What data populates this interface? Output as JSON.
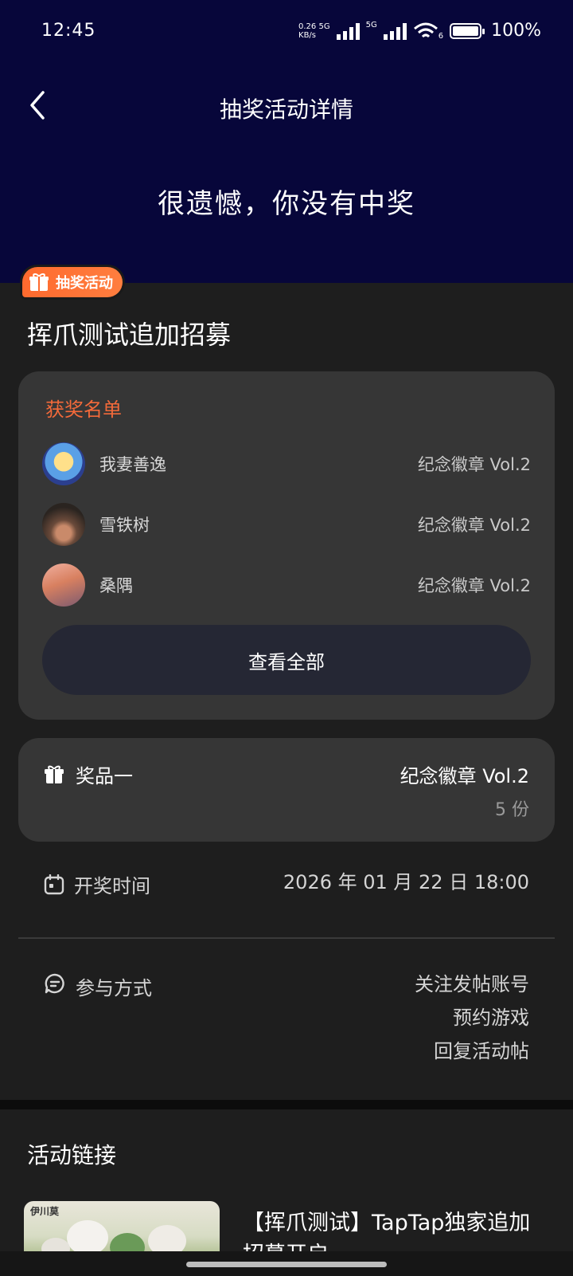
{
  "status_bar": {
    "time": "12:45",
    "net_speed_value": "0.26",
    "net_speed_unit": "KB/s",
    "sim1": "5G",
    "sim2": "5G",
    "wifi_label": "6",
    "battery": "100%"
  },
  "header": {
    "title": "抽奖活动详情",
    "result_text": "很遗憾，你没有中奖"
  },
  "event": {
    "badge_label": "抽奖活动",
    "title": "挥爪测试追加招募"
  },
  "winners": {
    "label": "获奖名单",
    "items": [
      {
        "name": "我妻善逸",
        "prize": "纪念徽章 Vol.2"
      },
      {
        "name": "雪铁树",
        "prize": "纪念徽章 Vol.2"
      },
      {
        "name": "桑隅",
        "prize": "纪念徽章 Vol.2"
      }
    ],
    "view_all": "查看全部"
  },
  "prize": {
    "label": "奖品一",
    "name": "纪念徽章 Vol.2",
    "quantity": "5 份"
  },
  "draw_time": {
    "label": "开奖时间",
    "value": "2026 年 01 月 22 日 18:00"
  },
  "participation": {
    "label": "参与方式",
    "methods": [
      "关注发帖账号",
      "预约游戏",
      "回复活动帖"
    ]
  },
  "links": {
    "title": "活动链接",
    "thumb_logo": "伊川莫",
    "post_title": "【挥爪测试】TapTap独家追加招募开启"
  },
  "colors": {
    "header_bg": "#07063a",
    "accent": "#f46a3a",
    "page_bg": "#1e1e1e",
    "card_bg": "#363636"
  },
  "icons": [
    "back-arrow-icon",
    "gift-icon",
    "calendar-icon",
    "chat-icon",
    "wifi-icon",
    "battery-icon"
  ]
}
